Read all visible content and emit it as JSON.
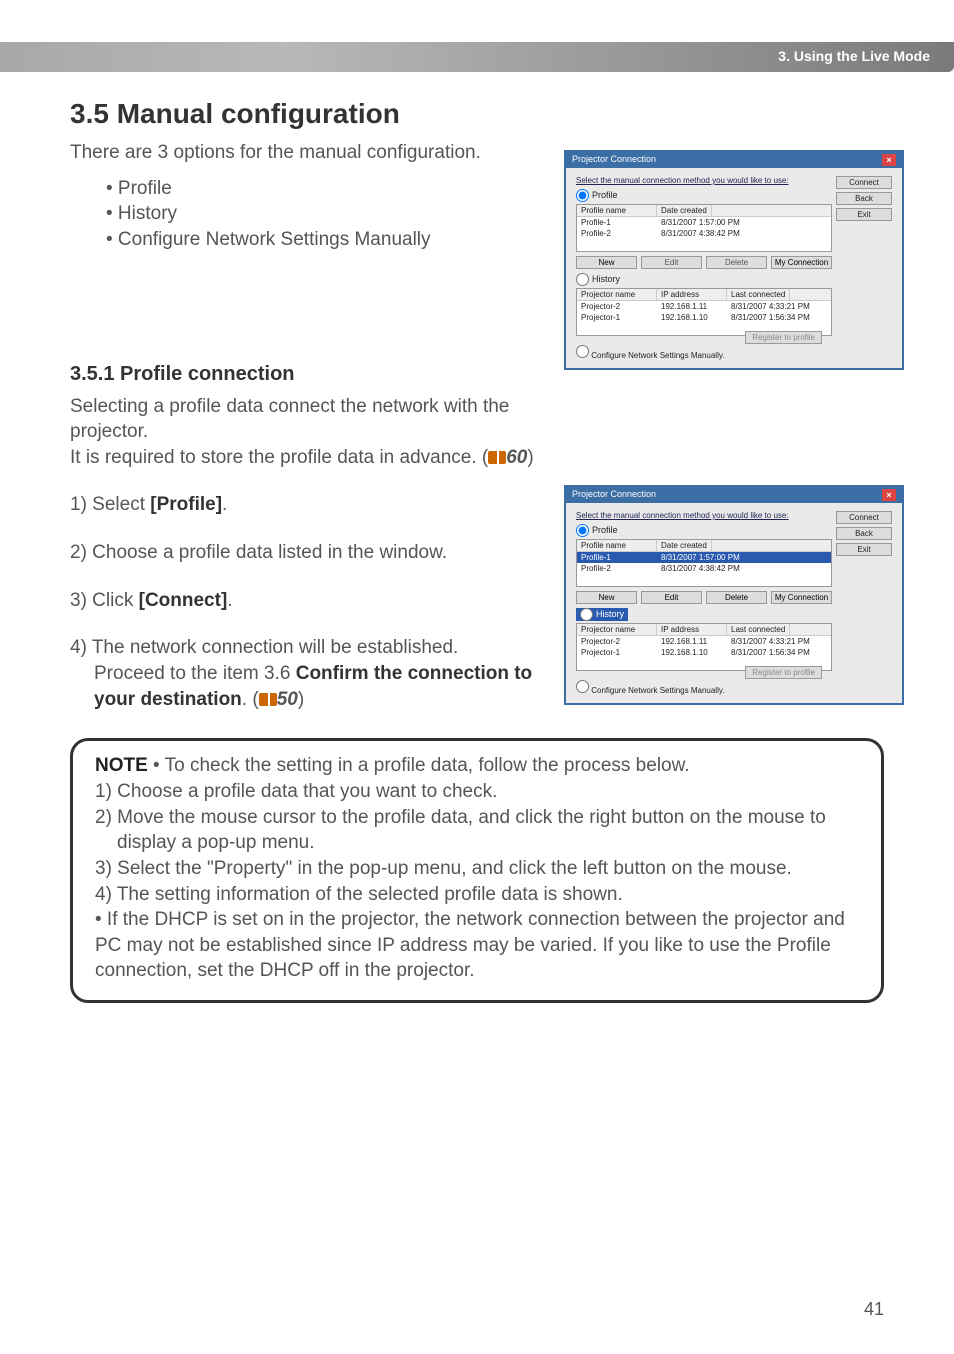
{
  "chapter": "3. Using the Live Mode",
  "h1": "3.5 Manual configuration",
  "intro": "There are 3 options for the manual configuration.",
  "bullets": {
    "b1": "• Profile",
    "b2": "• History",
    "b3": "• Configure Network Settings Manually"
  },
  "h2": "3.5.1 Profile connection",
  "profile_body_1": "Selecting a profile data connect the network with the projector.",
  "profile_body_2_pre": "It is required to store the profile data in advance. (",
  "profile_body_2_ref": "60",
  "profile_body_2_post": ")",
  "step1_pre": "1) Select ",
  "step1_bold": "[Profile]",
  "step1_post": ".",
  "step2": "2) Choose a profile data listed in the window.",
  "step3_pre": "3) Click ",
  "step3_bold": "[Connect]",
  "step3_post": ".",
  "step4_line1": "4) The network connection will be established.",
  "step4_line2_pre": "Proceed to the item 3.6 ",
  "step4_line2_bold": "Confirm the connection to your destination",
  "step4_line2_post": ". (",
  "step4_line2_ref": "50",
  "step4_line2_end": ")",
  "note": {
    "label": "NOTE",
    "lead": "  • To check the setting in a profile data, follow the process below.",
    "n1": "1) Choose a profile data that you want to check.",
    "n2": "2) Move the mouse cursor to the profile data, and click the right button on the mouse to display a pop-up menu.",
    "n3": "3) Select the \"Property\" in the pop-up menu, and click the left button on the mouse.",
    "n4": "4) The setting information of the selected profile data is shown.",
    "n5": "• If the DHCP is set on in the projector, the network connection between the projector and PC may not be established since IP address may be varied. If you like to use the Profile connection, set the DHCP off in the projector."
  },
  "page_num": "41",
  "dialog": {
    "title": "Projector Connection",
    "hint": "Select the manual connection method you would like to use:",
    "radio_profile": "Profile",
    "radio_history": "History",
    "hd_profile_name": "Profile name",
    "hd_date_created": "Date created",
    "row_p1_name": "Profile-1",
    "row_p1_date": "8/31/2007 1:57:00 PM",
    "row_p2_name": "Profile-2",
    "row_p2_date": "8/31/2007 4:38:42 PM",
    "hd_proj_name": "Projector name",
    "hd_ip": "IP address",
    "hd_last": "Last connected",
    "row_pr2_name": "Projector-2",
    "row_pr2_ip": "192.168.1.11",
    "row_pr2_last": "8/31/2007 4:33:21 PM",
    "row_pr1_name": "Projector-1",
    "row_pr1_ip": "192.168.1.10",
    "row_pr1_last": "8/31/2007 1:56:34 PM",
    "btn_new": "New",
    "btn_edit": "Edit",
    "btn_delete": "Delete",
    "btn_myconn": "My Connection",
    "btn_connect": "Connect",
    "btn_back": "Back",
    "btn_exit": "Exit",
    "btn_register": "Register to profile",
    "conf_label": "Configure Network Settings Manually."
  }
}
